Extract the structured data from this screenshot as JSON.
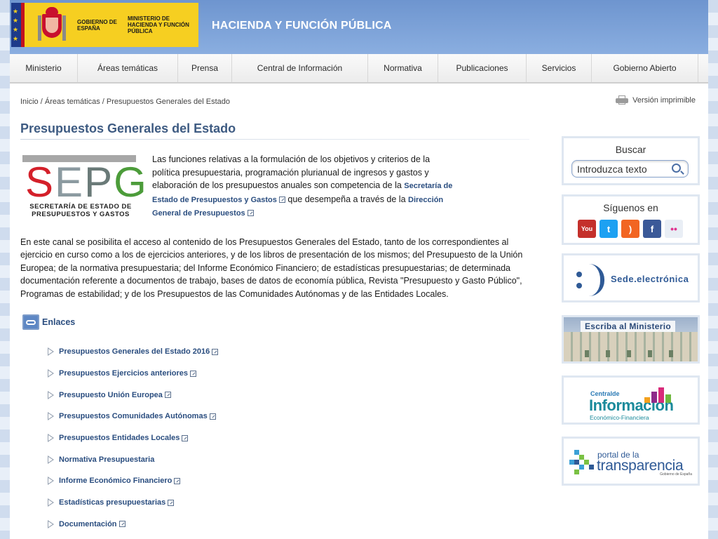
{
  "header": {
    "gov_line": "GOBIERNO DE ESPAÑA",
    "ministry_line": "MINISTERIO DE HACIENDA Y FUNCIÓN PÚBLICA",
    "site_title": "HACIENDA Y FUNCIÓN PÚBLICA"
  },
  "nav": [
    {
      "label": "Ministerio",
      "w": 97
    },
    {
      "label": "Áreas temáticas",
      "w": 143
    },
    {
      "label": "Prensa",
      "w": 77
    },
    {
      "label": "Central de Información",
      "w": 194
    },
    {
      "label": "Normativa",
      "w": 100
    },
    {
      "label": "Publicaciones",
      "w": 126
    },
    {
      "label": "Servicios",
      "w": 93
    },
    {
      "label": "Gobierno Abierto",
      "w": 152
    }
  ],
  "breadcrumb": {
    "home": "Inicio",
    "areas": "Áreas temáticas",
    "current": "Presupuestos Generales del Estado"
  },
  "print_label": "Versión imprimible",
  "page_title": "Presupuestos Generales del Estado",
  "sepg": {
    "letters": "SEPG",
    "subtitle_1": "SECRETARÍA DE ESTADO DE",
    "subtitle_2": "PRESUPUESTOS Y GASTOS"
  },
  "intro": {
    "text_before": "Las funciones relativas a la formulación de los objetivos y criterios de la política presupuestaria, programación plurianual de ingresos y gastos y elaboración de los presupuestos anuales son competencia de la ",
    "link_1": "Secretaría de Estado de Presupuestos y Gastos",
    "text_middle": " que desempeña a través de la ",
    "link_2": "Dirección General de Presupuestos"
  },
  "paragraph": "En este canal se posibilita el acceso al contenido de los Presupuestos Generales del Estado, tanto de los correspondientes al ejercicio en curso como a los de ejercicios anteriores, y de los libros de presentación de los mismos; del Presupuesto de la Unión Europea; de la normativa presupuestaria; del Informe Económico Financiero; de estadísticas presupuestarias; de determinada documentación referente a documentos de trabajo, bases de datos de economía pública, Revista \"Presupuesto y Gasto Público\", Programas de estabilidad; y de los Presupuestos de las Comunidades Autónomas y de las Entidades Locales.",
  "enlaces_title": "Enlaces",
  "links": [
    {
      "label": "Presupuestos Generales del Estado 2016",
      "external": true
    },
    {
      "label": "Presupuestos Ejercicios anteriores",
      "external": true
    },
    {
      "label": "Presupuesto Unión Europea",
      "external": true
    },
    {
      "label": "Presupuestos Comunidades Autónomas",
      "external": true
    },
    {
      "label": "Presupuestos Entidades Locales",
      "external": true
    },
    {
      "label": "Normativa Presupuestaria",
      "external": false
    },
    {
      "label": "Informe Económico Financiero",
      "external": true
    },
    {
      "label": "Estadísticas presupuestarias",
      "external": true
    },
    {
      "label": "Documentación",
      "external": true
    }
  ],
  "sidebar": {
    "search_title": "Buscar",
    "search_placeholder": "Introduzca texto",
    "follow_title": "Síguenos en",
    "social": [
      {
        "name": "youtube-icon",
        "glyph": "You",
        "color": "#c4302b"
      },
      {
        "name": "twitter-icon",
        "glyph": "t",
        "color": "#1da1f2"
      },
      {
        "name": "rss-icon",
        "glyph": ")",
        "color": "#f26522"
      },
      {
        "name": "facebook-icon",
        "glyph": "f",
        "color": "#3b5998"
      },
      {
        "name": "flickr-icon",
        "glyph": "••",
        "color": "#e9eef5"
      }
    ],
    "sede_label": "Sede.electrónica",
    "escriba_label": "Escriba al Ministerio",
    "central_1": "Central",
    "central_de": "de",
    "central_2": "Información",
    "central_3": "Económico-Financiera",
    "portal_1": "portal de la",
    "portal_2": "transparencia",
    "portal_3": "Gobierno de España"
  }
}
